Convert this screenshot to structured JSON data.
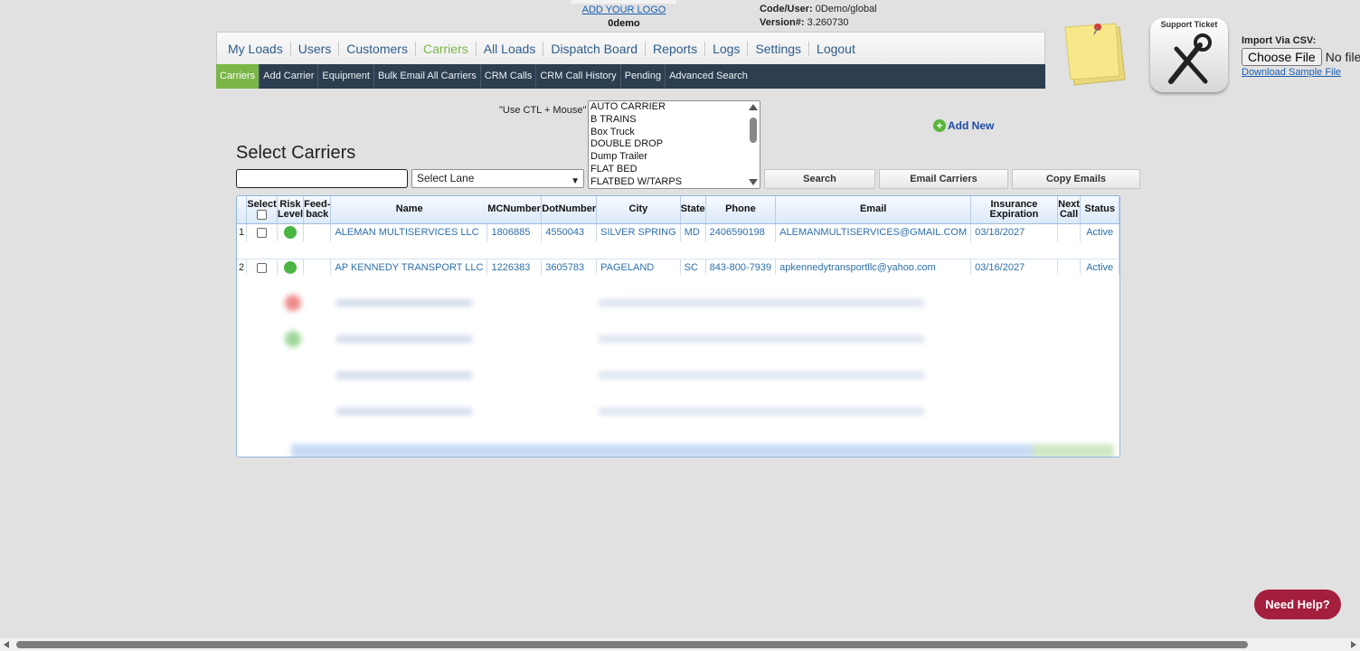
{
  "header": {
    "logo_link": "ADD YOUR LOGO",
    "company": "0demo",
    "code_user_label": "Code/User:",
    "code_user_value": "0Demo/global",
    "version_label": "Version#:",
    "version_value": "3.260730"
  },
  "nav": {
    "items": [
      "My Loads",
      "Users",
      "Customers",
      "Carriers",
      "All Loads",
      "Dispatch Board",
      "Reports",
      "Logs",
      "Settings",
      "Logout"
    ],
    "active": "Carriers"
  },
  "subnav": {
    "items": [
      "Carriers",
      "Add Carrier",
      "Equipment",
      "Bulk Email All Carriers",
      "CRM Calls",
      "CRM Call History",
      "Pending",
      "Advanced Search"
    ],
    "active": "Carriers"
  },
  "support_ticket": "Support Ticket",
  "csv": {
    "title": "Import Via CSV:",
    "choose_file": "Choose File",
    "no_file": "No file c",
    "download": "Download Sample File"
  },
  "filters": {
    "ctl_hint": "\"Use CTL + Mouse\"",
    "equipment_options": [
      "AUTO CARRIER",
      "B TRAINS",
      "Box Truck",
      "DOUBLE DROP",
      "Dump Trailer",
      "FLAT BED",
      "FLATBED W/TARPS"
    ],
    "lane_select": "Select Lane",
    "search_value": "",
    "search_button": "Search",
    "email_button": "Email Carriers",
    "copy_button": "Copy Emails"
  },
  "add_new": "Add New",
  "page_title": "Select Carriers",
  "table": {
    "columns": [
      "Select",
      "Risk Level",
      "Feed-back",
      "Name",
      "MCNumber",
      "DotNumber",
      "City",
      "State",
      "Phone",
      "Email",
      "Insurance Expiration",
      "Next Call",
      "Status"
    ],
    "col_select": "Select",
    "col_risk_1": "Risk",
    "col_risk_2": "Level",
    "col_feed_1": "Feed-",
    "col_feed_2": "back",
    "col_name": "Name",
    "col_mc": "MCNumber",
    "col_dot": "DotNumber",
    "col_city": "City",
    "col_state": "State",
    "col_phone": "Phone",
    "col_email": "Email",
    "col_ins": "Insurance Expiration",
    "col_next_1": "Next",
    "col_next_2": "Call",
    "col_status": "Status",
    "rows": [
      {
        "n": "1",
        "risk": "#4bb543",
        "name": "ALEMAN MULTISERVICES LLC",
        "mc": "1806885",
        "dot": "4550043",
        "city": "SILVER SPRING",
        "state": "MD",
        "phone": "2406590198",
        "email": "ALEMANMULTISERVICES@GMAIL.COM",
        "ins": "03/18/2027",
        "next": "",
        "status": "Active"
      },
      {
        "n": "2",
        "risk": "#4bb543",
        "name": "AP KENNEDY TRANSPORT LLC",
        "mc": "1226383",
        "dot": "3605783",
        "city": "PAGELAND",
        "state": "SC",
        "phone": "843-800-7939",
        "email": "apkennedytransportllc@yahoo.com",
        "ins": "03/16/2027",
        "next": "",
        "status": "Active"
      }
    ]
  },
  "need_help": "Need Help?",
  "colors": {
    "accent_green": "#7ab648",
    "subnav_bg": "#2c3e50",
    "help_red": "#a41e3d",
    "link_blue": "#2d6fab"
  }
}
